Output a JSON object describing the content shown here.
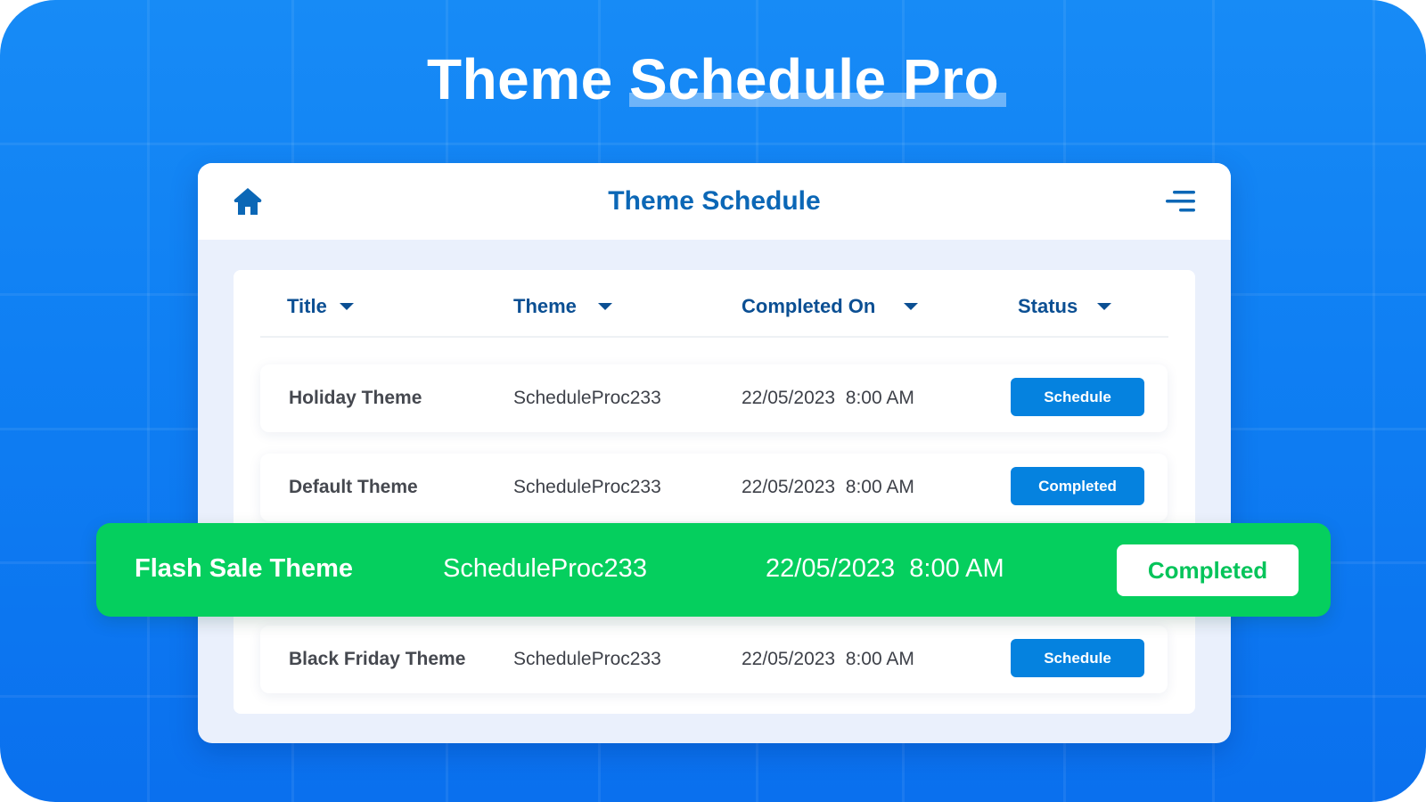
{
  "hero": {
    "title_part1": "Theme",
    "title_part2": "Schedule Pro"
  },
  "colors": {
    "brand_blue": "#178bf6",
    "header_text": "#0b67b6",
    "column_header_text": "#0b4f93",
    "button_blue": "#0582df",
    "highlight_green": "#05cf5e"
  },
  "panel": {
    "title": "Theme Schedule",
    "home_icon": "home-icon",
    "menu_icon": "menu-lines-icon"
  },
  "table": {
    "columns": [
      {
        "label": "Title",
        "icon": "caret-down-icon"
      },
      {
        "label": "Theme",
        "icon": "caret-down-icon"
      },
      {
        "label": "Completed On",
        "icon": "caret-down-icon"
      },
      {
        "label": "Status",
        "icon": "caret-down-icon"
      }
    ],
    "rows": [
      {
        "title": "Holiday Theme",
        "theme": "ScheduleProc233",
        "completed_on": "22/05/2023  8:00 AM",
        "status": "Schedule"
      },
      {
        "title": "Default Theme",
        "theme": "ScheduleProc233",
        "completed_on": "22/05/2023  8:00 AM",
        "status": "Completed"
      },
      {
        "title": "Flash Sale Theme",
        "theme": "ScheduleProc233",
        "completed_on": "22/05/2023  8:00 AM",
        "status": "Completed",
        "highlighted": true
      },
      {
        "title": "Black Friday Theme",
        "theme": "ScheduleProc233",
        "completed_on": "22/05/2023  8:00 AM",
        "status": "Schedule"
      }
    ]
  }
}
